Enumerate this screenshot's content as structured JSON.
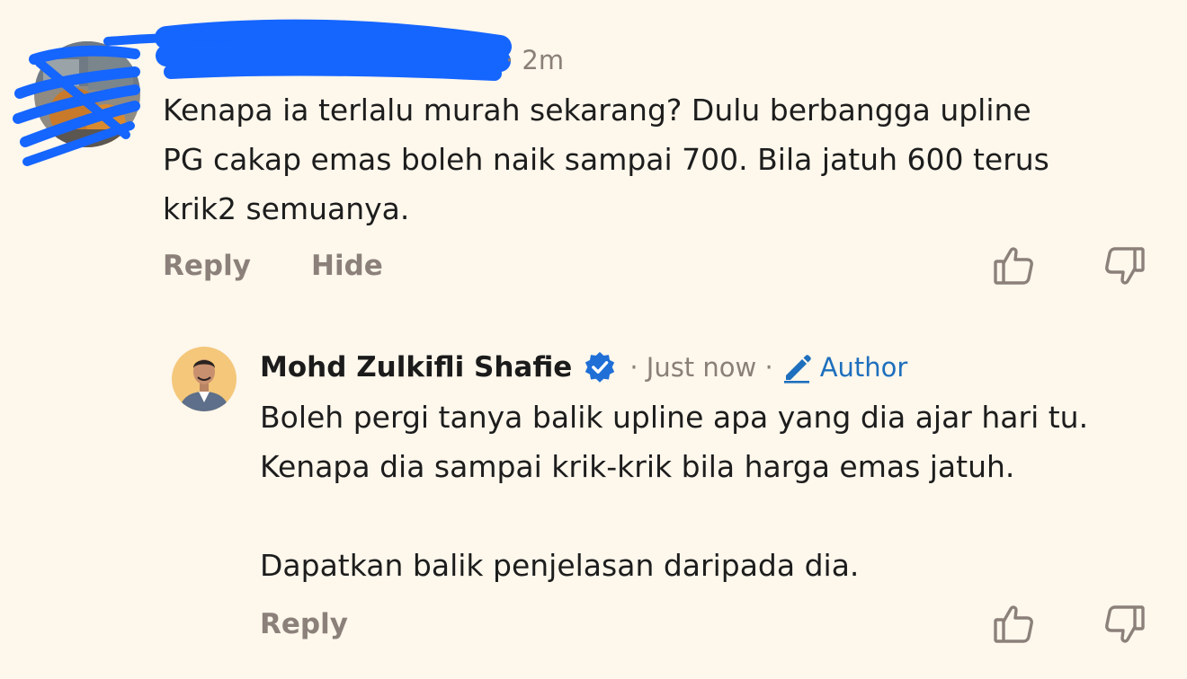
{
  "parent_comment": {
    "timestamp": "· 2m",
    "body_lines": [
      "Kenapa ia terlalu murah sekarang? Dulu berbangga upline",
      "PG cakap emas boleh naik sampai 700. Bila jatuh 600 terus",
      "krik2 semuanya."
    ],
    "actions": {
      "reply": "Reply",
      "hide": "Hide"
    }
  },
  "reply_comment": {
    "author": "Mohd Zulkifli Shafie",
    "meta": "· Just now ·",
    "badge": "Author",
    "body_lines": [
      "Boleh pergi tanya balik upline apa yang dia ajar hari tu.",
      "Kenapa dia sampai krik-krik bila harga emas jatuh.",
      "",
      "Dapatkan balik penjelasan daripada dia."
    ],
    "actions": {
      "reply": "Reply"
    }
  },
  "colors": {
    "background": "#fdf7ec",
    "muted_text": "#8a8078",
    "accent_blue": "#1e6fbd",
    "redaction_blue": "#1565ff"
  },
  "icons": {
    "like": "thumbs-up-icon",
    "dislike": "thumbs-down-icon",
    "verified": "verified-check-icon",
    "author": "pencil-icon"
  }
}
